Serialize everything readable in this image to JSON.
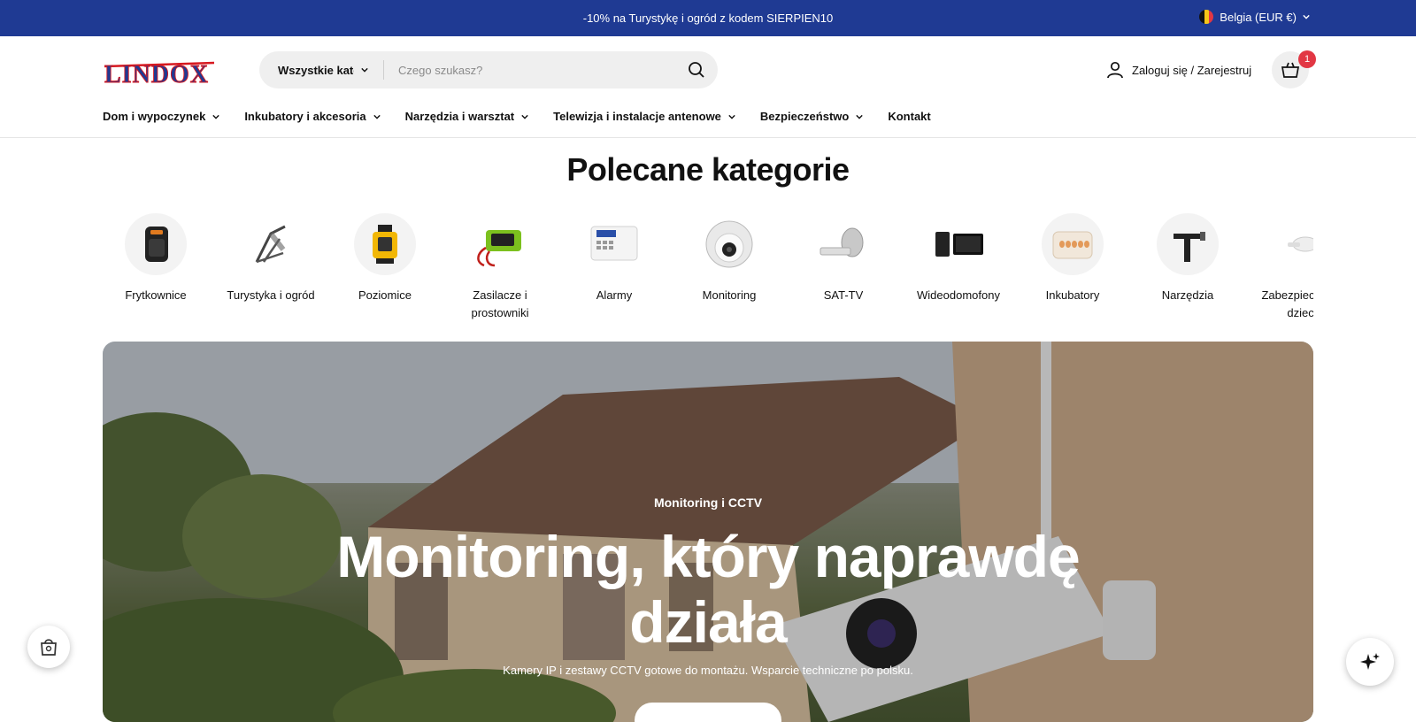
{
  "announcement": {
    "message": "-10% na Turystykę i ogród z kodem SIERPIEN10",
    "country_label": "Belgia (EUR €)"
  },
  "header": {
    "logo_text": "LINDOX",
    "search": {
      "category_label": "Wszystkie kategorie",
      "placeholder": "Czego szukasz?"
    },
    "account_label": "Zaloguj się / Zarejestruj",
    "cart_count": "1"
  },
  "nav": {
    "items": [
      {
        "label": "Dom i wypoczynek",
        "has_dropdown": true
      },
      {
        "label": "Inkubatory i akcesoria",
        "has_dropdown": true
      },
      {
        "label": "Narzędzia i warsztat",
        "has_dropdown": true
      },
      {
        "label": "Telewizja i instalacje antenowe",
        "has_dropdown": true
      },
      {
        "label": "Bezpieczeństwo",
        "has_dropdown": true
      },
      {
        "label": "Kontakt",
        "has_dropdown": false
      }
    ]
  },
  "featured": {
    "title": "Polecane kategorie",
    "categories": [
      {
        "label": "Frytkownice",
        "icon": "air-fryer-icon"
      },
      {
        "label": "Turystyka i ogród",
        "icon": "lounger-chair-icon"
      },
      {
        "label": "Poziomice",
        "icon": "laser-level-icon"
      },
      {
        "label": "Zasilacze i prostowniki",
        "icon": "battery-charger-icon"
      },
      {
        "label": "Alarmy",
        "icon": "alarm-panel-icon"
      },
      {
        "label": "Monitoring",
        "icon": "dome-camera-icon"
      },
      {
        "label": "SAT-TV",
        "icon": "satellite-dish-icon"
      },
      {
        "label": "Wideodomofony",
        "icon": "video-intercom-icon"
      },
      {
        "label": "Inkubatory",
        "icon": "incubator-icon"
      },
      {
        "label": "Narzędzia",
        "icon": "tool-icon"
      },
      {
        "label": "Zabezpieczenia dzieci",
        "icon": "child-safety-icon"
      }
    ]
  },
  "hero": {
    "eyebrow": "Monitoring i CCTV",
    "headline": "Monitoring, który naprawdę działa",
    "subtitle": "Kamery IP i zestawy CCTV gotowe do montażu. Wsparcie techniczne po polsku."
  },
  "colors": {
    "announcement_bg": "#1f3a93",
    "logo_red": "#d71920",
    "logo_blue": "#1f3a93",
    "cart_badge": "#e23744"
  }
}
